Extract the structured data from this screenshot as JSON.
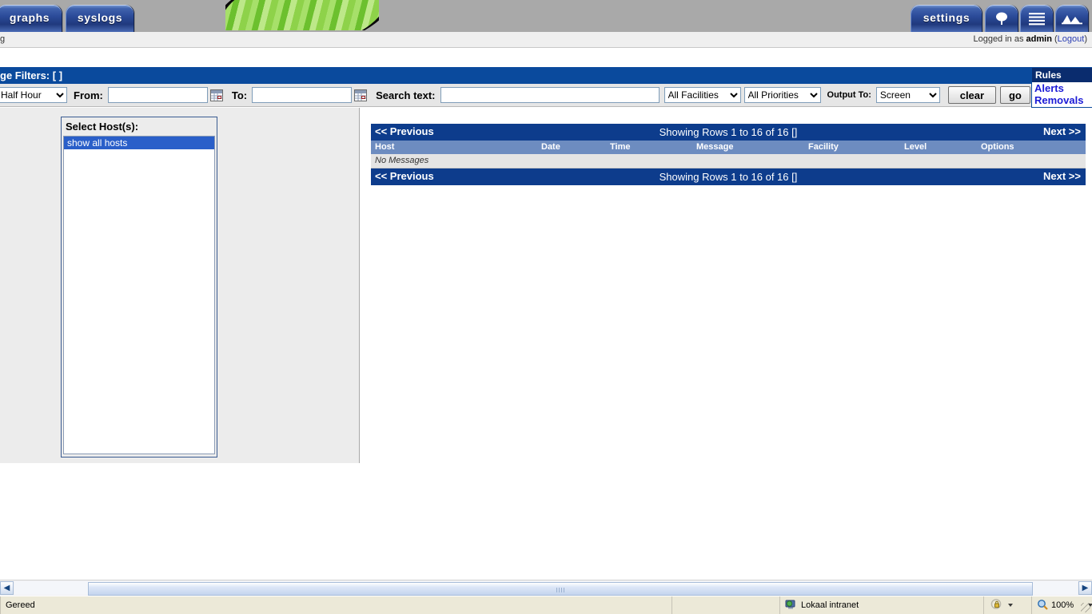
{
  "nav": {
    "tabs": [
      {
        "label": "graphs",
        "name": "tab-graphs"
      },
      {
        "label": "syslogs",
        "name": "tab-syslogs"
      },
      {
        "label": "settings",
        "name": "tab-settings"
      }
    ],
    "icon_tabs": [
      {
        "icon": "tree-icon"
      },
      {
        "icon": "list-lines-icon"
      },
      {
        "icon": "mountain-chart-icon"
      }
    ]
  },
  "session": {
    "cut_left_text": "g",
    "logged_in_prefix": "Logged in as ",
    "user": "admin",
    "logout_open": " (",
    "logout_label": "Logout",
    "logout_close": ")"
  },
  "filters": {
    "title": "ge Filters:",
    "title_suffix": "[ ]",
    "range_value": "Half Hour",
    "range_options": [
      "Half Hour"
    ],
    "from_label": "From:",
    "from_value": "",
    "to_label": "To:",
    "to_value": "",
    "search_label": "Search text:",
    "search_value": "",
    "facility_value": "All Facilities",
    "facility_options": [
      "All Facilities"
    ],
    "priority_value": "All Priorities",
    "priority_options": [
      "All Priorities"
    ],
    "output_label": "Output To:",
    "output_value": "Screen",
    "output_options": [
      "Screen"
    ],
    "clear_label": "clear",
    "go_label": "go"
  },
  "rules": {
    "header": "Rules",
    "links": [
      "Alerts",
      "Removals"
    ]
  },
  "hosts": {
    "title": "Select Host(s):",
    "options": [
      {
        "label": "show all hosts",
        "selected": true
      }
    ]
  },
  "results": {
    "prev_label": "<< Previous",
    "next_label": "Next >>",
    "showing": "Showing Rows 1 to 16 of 16 []",
    "columns": [
      "Host",
      "Date",
      "Time",
      "Message",
      "Facility",
      "Level",
      "Options"
    ],
    "empty_text": "No Messages"
  },
  "browser": {
    "status": "Gereed",
    "zone": "Lokaal intranet",
    "zone_icon": "monitor-globe-icon",
    "security_icon": "lock-icon",
    "zoom_icon": "magnifier-icon",
    "zoom_level": "100%"
  }
}
